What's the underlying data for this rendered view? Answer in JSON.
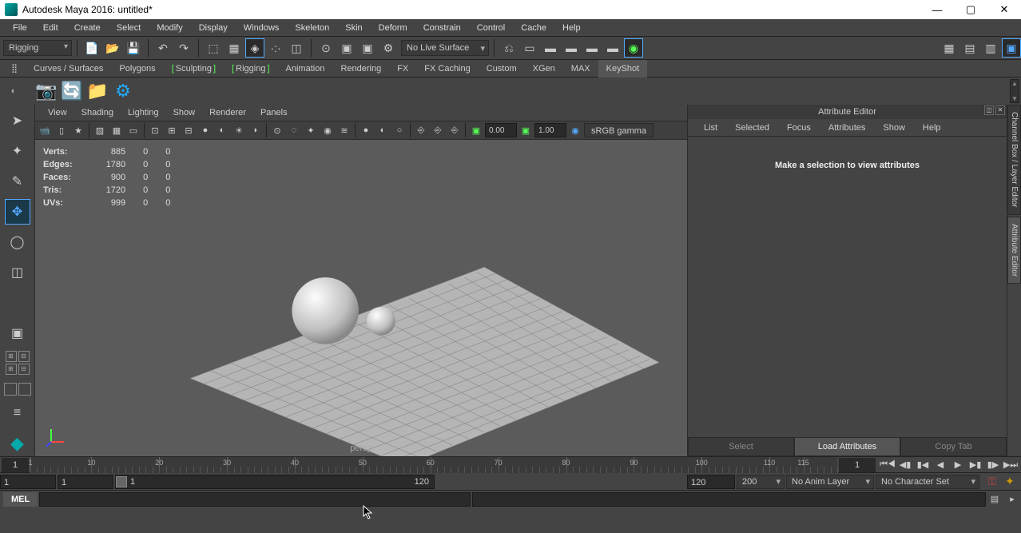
{
  "window": {
    "title": "Autodesk Maya 2016: untitled*"
  },
  "menus": [
    "File",
    "Edit",
    "Create",
    "Select",
    "Modify",
    "Display",
    "Windows",
    "Skeleton",
    "Skin",
    "Deform",
    "Constrain",
    "Control",
    "Cache",
    "Help"
  ],
  "workspace_combo": "Rigging",
  "no_live": "No Live Surface",
  "shelf_tabs": [
    "Curves / Surfaces",
    "Polygons",
    "Sculpting",
    "Rigging",
    "Animation",
    "Rendering",
    "FX",
    "FX Caching",
    "Custom",
    "XGen",
    "MAX",
    "KeyShot"
  ],
  "shelf_tabs_green": [
    2,
    3
  ],
  "shelf_tab_active": 11,
  "viewport": {
    "menus": [
      "View",
      "Shading",
      "Lighting",
      "Show",
      "Renderer",
      "Panels"
    ],
    "near_clip": "0.00",
    "far_clip": "1.00",
    "gamma": "sRGB gamma",
    "camera": "persp",
    "stats": {
      "rows": [
        {
          "label": "Verts:",
          "a": "885",
          "b": "0",
          "c": "0"
        },
        {
          "label": "Edges:",
          "a": "1780",
          "b": "0",
          "c": "0"
        },
        {
          "label": "Faces:",
          "a": "900",
          "b": "0",
          "c": "0"
        },
        {
          "label": "Tris:",
          "a": "1720",
          "b": "0",
          "c": "0"
        },
        {
          "label": "UVs:",
          "a": "999",
          "b": "0",
          "c": "0"
        }
      ]
    }
  },
  "attr": {
    "title": "Attribute Editor",
    "menus": [
      "List",
      "Selected",
      "Focus",
      "Attributes",
      "Show",
      "Help"
    ],
    "empty": "Make a selection to view attributes",
    "buttons": {
      "select": "Select",
      "load": "Load Attributes",
      "copy": "Copy Tab"
    }
  },
  "side_tabs": [
    "Channel Box / Layer Editor",
    "Attribute Editor"
  ],
  "timeline": {
    "current": "1",
    "display": "1",
    "ticks": [
      1,
      10,
      20,
      30,
      40,
      50,
      60,
      70,
      80,
      90,
      100,
      110,
      115
    ]
  },
  "range": {
    "start": "1",
    "inner_start": "1",
    "slider_start": "1",
    "slider_end": "120",
    "inner_end": "120",
    "end": "200",
    "anim_layer": "No Anim Layer",
    "char_set": "No Character Set"
  },
  "cmd": {
    "lang": "MEL"
  }
}
